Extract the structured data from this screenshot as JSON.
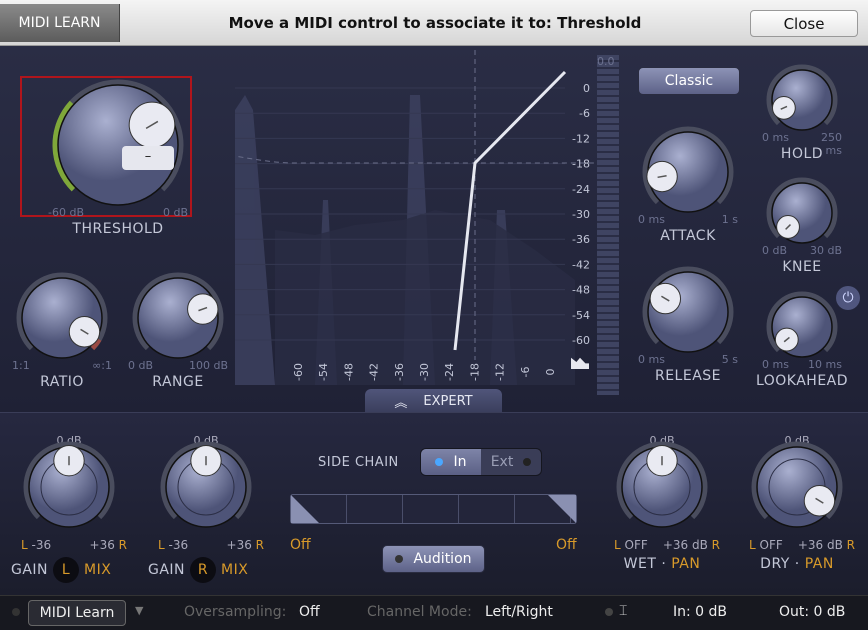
{
  "topbar": {
    "midi_learn": "MIDI LEARN",
    "title": "Move a MIDI control to associate it to: Threshold",
    "close": "Close"
  },
  "knobs": {
    "threshold": {
      "label": "THRESHOLD",
      "min": "-60 dB",
      "max": "0 dB",
      "value": 0.72
    },
    "ratio": {
      "label": "RATIO",
      "min": "1:1",
      "max": "∞:1",
      "value": 0.95
    },
    "range": {
      "label": "RANGE",
      "min": "0 dB",
      "max": "100 dB",
      "value": 0.76
    },
    "attack": {
      "label": "ATTACK",
      "min": "0 ms",
      "max": "1 s",
      "value": 0.13
    },
    "release": {
      "label": "RELEASE",
      "min": "0 ms",
      "max": "5 s",
      "value": 0.28
    },
    "hold": {
      "label": "HOLD",
      "min": "0 ms",
      "max": "250 ms",
      "value": 0.08
    },
    "knee": {
      "label": "KNEE",
      "min": "0 dB",
      "max": "30 dB",
      "value": 0.0
    },
    "lookahead": {
      "label": "LOOKAHEAD",
      "min": "0 ms",
      "max": "10 ms",
      "value": 0.02
    }
  },
  "mode_button": "Classic",
  "graph": {
    "x_ticks": [
      "-60",
      "-54",
      "-48",
      "-42",
      "-36",
      "-30",
      "-24",
      "-18",
      "-12",
      "-6",
      "0"
    ],
    "y_ticks": [
      "0",
      "-6",
      "-12",
      "-18",
      "-24",
      "-30",
      "-36",
      "-42",
      "-48",
      "-54",
      "-60"
    ],
    "threshold_db": -18,
    "meter_peak": "0.0"
  },
  "expert": "EXPERT",
  "bottom": {
    "gain_l": {
      "value": "0 dB",
      "min": "L -36",
      "max": "+36 R",
      "gain": "GAIN",
      "ch": "L",
      "mix": "MIX"
    },
    "gain_r": {
      "value": "0 dB",
      "min": "L -36",
      "max": "+36 R",
      "gain": "GAIN",
      "ch": "R",
      "mix": "MIX"
    },
    "wet": {
      "value": "0 dB",
      "min": "L OFF",
      "max": "+36 dB R",
      "name": "WET",
      "pan": "PAN"
    },
    "dry": {
      "value": "0 dB",
      "min": "L OFF",
      "max": "+36 dB R",
      "name": "DRY",
      "pan": "PAN"
    },
    "sidechain": {
      "label": "SIDE CHAIN",
      "in": "In",
      "ext": "Ext",
      "low": "Off",
      "high": "Off"
    },
    "audition": "Audition"
  },
  "status": {
    "midi_learn": "MIDI Learn",
    "oversampling_label": "Oversampling:",
    "oversampling": "Off",
    "channel_label": "Channel Mode:",
    "channel": "Left/Right",
    "in": "In: 0 dB",
    "out": "Out: 0 dB"
  },
  "colors": {
    "accent": "#d89a2a",
    "select": "#b0151c",
    "threshold_arc": "#7fa83a"
  }
}
